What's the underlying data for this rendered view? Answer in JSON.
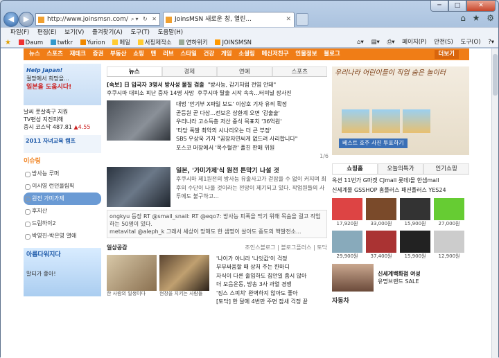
{
  "browser": {
    "address": "http://www.joinsmsn.com/",
    "tab_title": "JoinsMSN 새로운 창, 열린...",
    "menu": [
      "파일(F)",
      "편집(E)",
      "보기(V)",
      "즐겨찾기(A)",
      "도구(T)",
      "도움말(H)"
    ],
    "favorites": [
      "Daum",
      "twtkr",
      "Yurion",
      "메일",
      "서핑제작소",
      "연하위키",
      "JOINSMSN"
    ],
    "commands": [
      "페이지(P)",
      "안전(S)",
      "도구(O)"
    ]
  },
  "nav": {
    "items": [
      "뉴스",
      "스포츠",
      "재테크",
      "증권",
      "부동산",
      "쇼핑",
      "맨",
      "러브",
      "스타일",
      "건강",
      "게임",
      "소셜링",
      "메신저친구",
      "인물정보",
      "블로그"
    ],
    "more": "더보기"
  },
  "left": {
    "ad_title": "Help Japan!",
    "ad_red": "일본을 도웁시다!",
    "ad_line1": "절망에서 희망을...",
    "misc": [
      "날씨",
      "풋살축구 지원",
      "TV편성",
      "지진피해",
      "증시",
      "코스닥 487.81",
      "▲4.55"
    ],
    "ad_sub": "2011 자녀교육 캠프",
    "issue_hdr": "이슈링",
    "issues": [
      "방사능 루머",
      "이시영 런던올림픽",
      "원전 가미가제",
      "후지산",
      "드림하이2",
      "박영진-박은영 열애"
    ],
    "ad2_title": "아름다워지다",
    "ad2_sub": "말티가 좋아!"
  },
  "mid": {
    "tabs": [
      "뉴스",
      "경제",
      "연예",
      "스포츠"
    ],
    "top": [
      "[속보] 日 입국자 3명서 방사성 물질 검출",
      "\"방사능, 감기처럼 전염 안돼\"",
      "후쿠시마 대피소 피난 중자 14명 사망",
      "후쿠시마 탈출 시작 속속...터미널 장사진"
    ],
    "photo1_list": [
      "대법 '안기부 X파일 보도' 이상호 기자 유죄 확정",
      "곧등원 곧 다상...전보은 상환계 오면 '감출술'",
      "우리나라 고소득층 저산 중식 목표치 '36억원'",
      "'타당 폭발 최악의 시나리오는 더 큰 부정'",
      "SBS 우상욱 기자 \"꿈장자연씨게 없드려 사리합니다\"",
      "포스코 머장에서 '목수혈관' 폴친 판매 위원"
    ],
    "pager": "1/6",
    "story_title": "일본, '가미가제'식 원전 튼막기 나설 것",
    "story_body": "후쿠시마 제1원전의 방사능 유출사고가 걷잡을 수 없이 커지며 최후의 수단이 나올 것이라는 전망이 제기되고 있다. 작업원들의 사투에도 불구하고...",
    "tweets": [
      "ongkyu 등장 RT @small_snail: RT @eqo7: 방사능 피폭을 막기 위해 목숨을 걸고 작업하는 50명이 있다.",
      "metavital @aleph_k 그래서 세상이 망해도 한 샘명이 살아도 중도의 핵발전소..."
    ],
    "life_title": "일상공감",
    "life_tags": [
      "조인스블로그",
      "블로그플러스",
      "토닥"
    ],
    "life_list": [
      "'나이가 아니라 '나잇값'이 걱정",
      "부부싸움할 때 상처 주는 한마디",
      "자식이 다른 출입하도 집안일 좀시 않아",
      "더 모음운동, 방송 3사 과열 경쟁",
      "'징스 스피치' 완벽하지 않아도 좋아",
      "[토닥] 한 달에 4번만 주면 잠새 걱정 끝"
    ],
    "life_caps": [
      "한 사람의 일생이다",
      "현장을 지키는 사람들"
    ]
  },
  "right": {
    "ad_text": "우리나라 어린이들이 직업 숨은 놀이터",
    "ad_btn": "베스트 호주 사진 투표하기",
    "shop_tabs": [
      "쇼핑홈",
      "오늘의특가",
      "인기쇼핑"
    ],
    "shop_line1": "옥션 11번가 G마켓 CJmall 롯데i몰 한샘mall",
    "shop_line2": "신세계몰 GSSHOP 홈플러스 패션플러스 YES24",
    "products": [
      {
        "name": "",
        "price": "17,920원"
      },
      {
        "name": "",
        "price": "33,000원"
      },
      {
        "name": "",
        "price": "15,900원"
      },
      {
        "name": "",
        "price": "27,000원"
      },
      {
        "name": "",
        "price": "29,900원"
      },
      {
        "name": "",
        "price": "37,400원"
      },
      {
        "name": "",
        "price": "15,900원"
      },
      {
        "name": "",
        "price": "12,900원"
      }
    ],
    "promo_title": "신세계백화점 여성",
    "promo_sub": "유명브랜드 SALE",
    "section": "자동차"
  }
}
